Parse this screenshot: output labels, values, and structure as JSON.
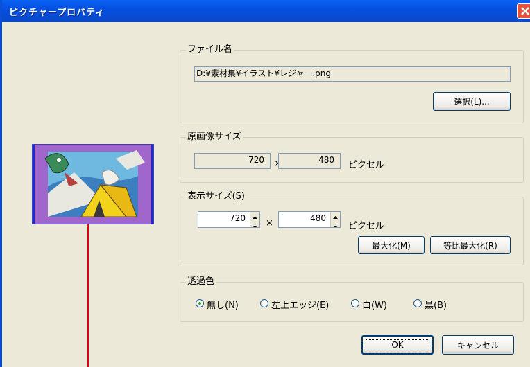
{
  "window": {
    "title": "ピクチャープロパティ"
  },
  "filename": {
    "group_label": "ファイル名",
    "path": "D:¥素材集¥イラスト¥レジャー.png",
    "select_button": "選択(L)..."
  },
  "original_size": {
    "group_label": "原画像サイズ",
    "width": "720",
    "times": "×",
    "height": "480",
    "unit": "ピクセル"
  },
  "display_size": {
    "group_label": "表示サイズ(S)",
    "width": "720",
    "times": "×",
    "height": "480",
    "unit": "ピクセル",
    "maximize_button": "最大化(M)",
    "ratio_maximize_button": "等比最大化(R)"
  },
  "transparency": {
    "group_label": "透過色",
    "options": [
      {
        "label": "無し(N)",
        "checked": true
      },
      {
        "label": "左上エッジ(E)",
        "checked": false
      },
      {
        "label": "白(W)",
        "checked": false
      },
      {
        "label": "黒(B)",
        "checked": false
      }
    ]
  },
  "buttons": {
    "ok": "OK",
    "cancel": "キャンセル"
  },
  "colors": {
    "title_bar": "#0A62F5",
    "dialog_bg": "#ECE9D8",
    "close_button": "#E2543B",
    "marker_line": "#E00010"
  }
}
